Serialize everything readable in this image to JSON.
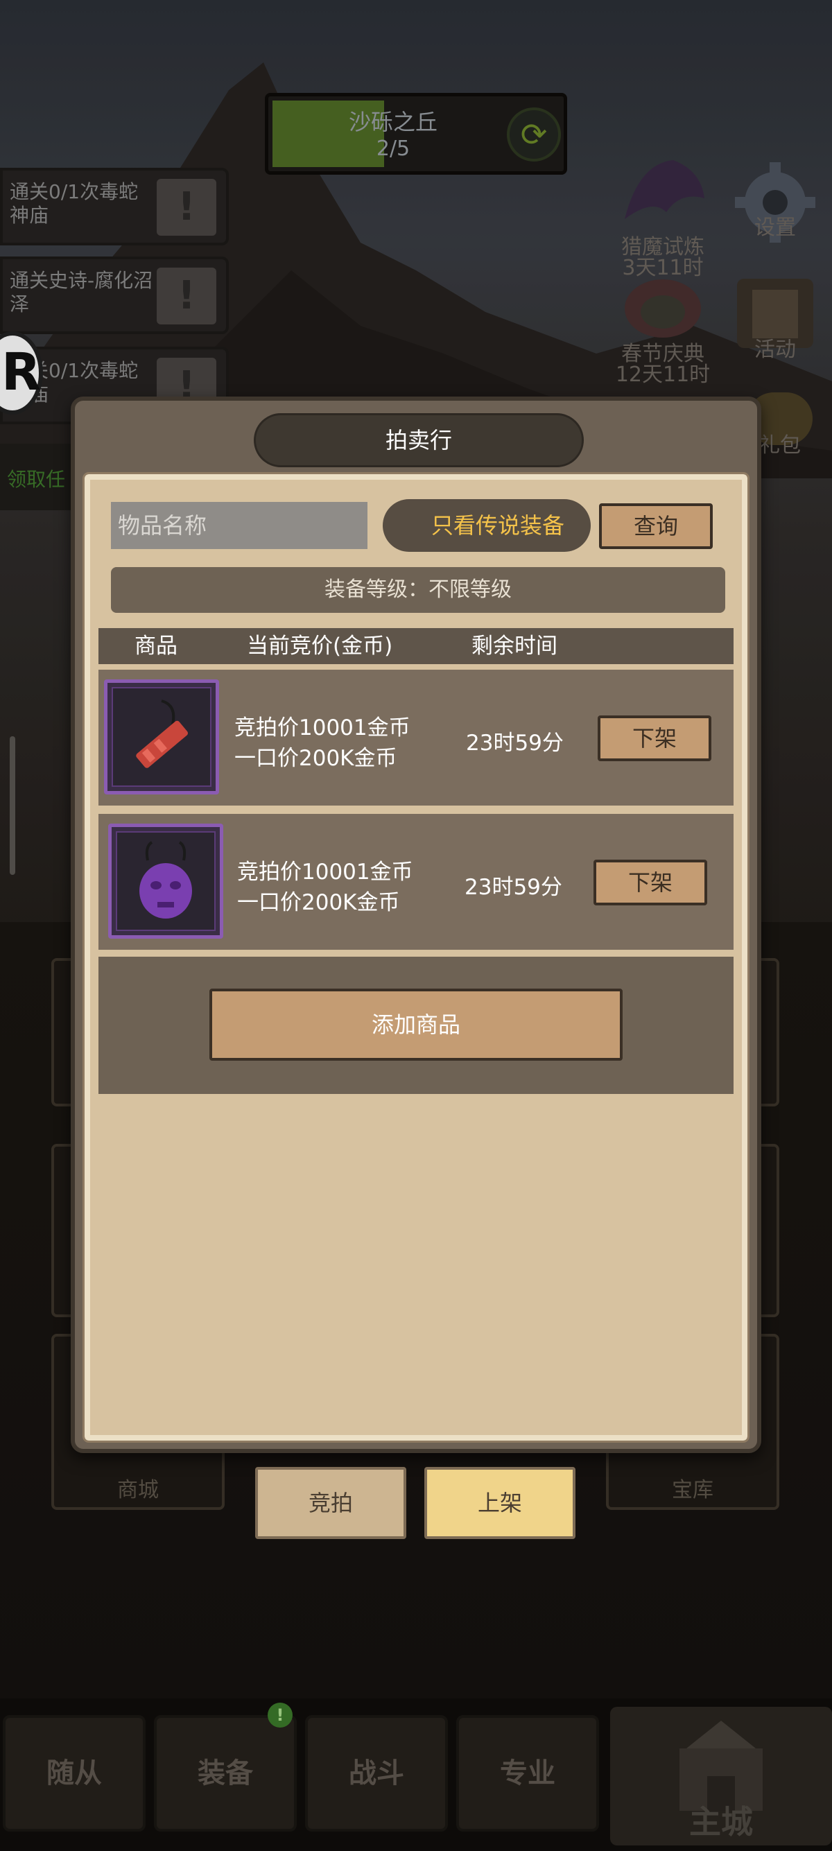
{
  "progress": {
    "stage": "沙砾之丘",
    "count": "2/5",
    "fill_fraction": 0.39
  },
  "quests": [
    {
      "text": "通关0/1次毒蛇神庙"
    },
    {
      "text": "通关史诗-腐化沼泽"
    },
    {
      "text": "通关0/1次毒蛇神庙"
    }
  ],
  "claim_task": "领取任",
  "r_badge": "R",
  "side_icons": [
    {
      "label": "猎魔试炼",
      "sub": "3天11时"
    },
    {
      "label": "设置"
    },
    {
      "label": "春节庆典",
      "sub": "12天11时"
    },
    {
      "label": "活动"
    },
    {
      "label": "礼包"
    }
  ],
  "background_tiles": {
    "shop": "商城",
    "vault": "宝库"
  },
  "bottom_nav": [
    {
      "label": "随从"
    },
    {
      "label": "装备",
      "badge": "!"
    },
    {
      "label": "战斗"
    },
    {
      "label": "专业"
    },
    {
      "label": "主城"
    }
  ],
  "dialog": {
    "title": "拍卖行",
    "search": {
      "placeholder": "物品名称",
      "value": ""
    },
    "legend_only_label": "只看传说装备",
    "query_label": "查询",
    "level_filter": "装备等级：不限等级",
    "table": {
      "headers": [
        "商品",
        "当前竞价(金币)",
        "剩余时间"
      ],
      "rows": [
        {
          "item_icon": "red-whistle-icon",
          "bid_price": "竞拍价10001金币",
          "buyout_price": "一口价200K金币",
          "remaining": "23时59分",
          "action": "下架"
        },
        {
          "item_icon": "purple-mask-icon",
          "bid_price": "竞拍价10001金币",
          "buyout_price": "一口价200K金币",
          "remaining": "23时59分",
          "action": "下架"
        }
      ]
    },
    "add_item_label": "添加商品",
    "tabs": [
      {
        "label": "竞拍",
        "active": false
      },
      {
        "label": "上架",
        "active": true
      }
    ]
  },
  "colors": {
    "panel": "#6d6154",
    "paper": "#d7c2a0",
    "button": "#c49c73",
    "legend_text": "#f4c24a",
    "epic_frame": "#8b5cb2",
    "active_tab": "#f0d48a"
  }
}
